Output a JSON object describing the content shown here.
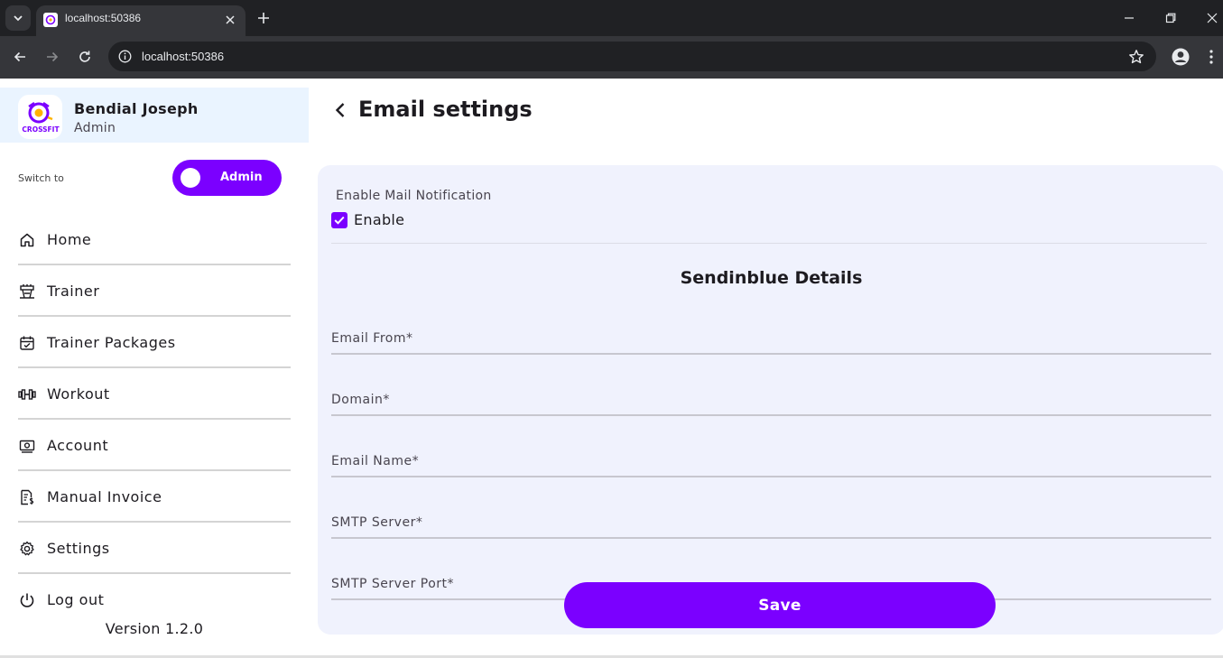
{
  "browser": {
    "tab_title": "localhost:50386",
    "url": "localhost:50386"
  },
  "sidebar": {
    "user_name": "Bendial Joseph",
    "user_role": "Admin",
    "avatar_text": "CROSSFIT",
    "switch_label": "Switch to",
    "switch_value": "Admin",
    "nav_items": [
      {
        "label": "Home",
        "icon": "home-icon"
      },
      {
        "label": "Trainer",
        "icon": "trainer-icon"
      },
      {
        "label": "Trainer Packages",
        "icon": "calendar-check-icon"
      },
      {
        "label": "Workout",
        "icon": "dumbbell-icon"
      },
      {
        "label": "Account",
        "icon": "money-icon"
      },
      {
        "label": "Manual Invoice",
        "icon": "invoice-icon"
      },
      {
        "label": "Settings",
        "icon": "gear-icon"
      },
      {
        "label": "Log out",
        "icon": "power-icon"
      }
    ],
    "version": "Version 1.2.0"
  },
  "main": {
    "title": "Email settings",
    "mail_notification_label": "Enable Mail Notification",
    "enable_label": "Enable",
    "enable_checked": true,
    "section_title": "Sendinblue Details",
    "fields": [
      {
        "label": "Email From*",
        "value": ""
      },
      {
        "label": "Domain*",
        "value": ""
      },
      {
        "label": "Email Name*",
        "value": ""
      },
      {
        "label": "SMTP Server*",
        "value": ""
      },
      {
        "label": "SMTP Server Port*",
        "value": ""
      }
    ],
    "save_label": "Save"
  },
  "colors": {
    "accent": "#7b00ff",
    "card_bg": "#f0f2fd",
    "profile_bg": "#eaf4ff"
  }
}
